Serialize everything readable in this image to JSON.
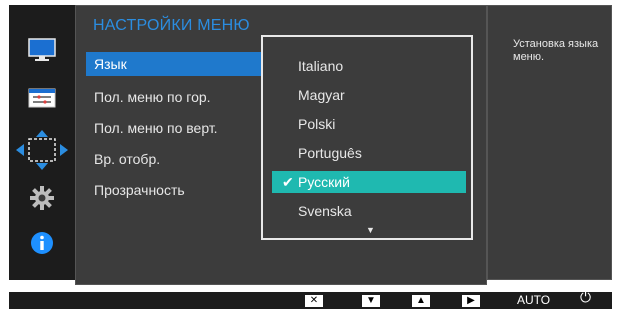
{
  "menu": {
    "title": "НАСТРОЙКИ МЕНЮ",
    "items": [
      {
        "label": "Язык",
        "selected": true
      },
      {
        "label": "Пол. меню по гор.",
        "selected": false
      },
      {
        "label": "Пол. меню по верт.",
        "selected": false
      },
      {
        "label": "Вр. отобр.",
        "selected": false
      },
      {
        "label": "Прозрачность",
        "selected": false
      }
    ]
  },
  "language_dropdown": {
    "options": [
      {
        "label": "Italiano",
        "selected": false
      },
      {
        "label": "Magyar",
        "selected": false
      },
      {
        "label": "Polski",
        "selected": false
      },
      {
        "label": "Português",
        "selected": false
      },
      {
        "label": "Русский",
        "selected": true
      },
      {
        "label": "Svenska",
        "selected": false
      }
    ],
    "check_glyph": "✔",
    "more_glyph": "▼"
  },
  "help": {
    "text": "Установка языка меню."
  },
  "sidebar_icons": [
    "picture-icon",
    "onscreen-display-icon",
    "position-adjust-icon",
    "settings-gear-icon",
    "info-icon"
  ],
  "bottom_bar": {
    "close_glyph": "✕",
    "down_glyph": "▼",
    "up_glyph": "▲",
    "enter_glyph": "▶",
    "auto_label": "AUTO",
    "power_glyph": "⏻"
  },
  "colors": {
    "accent_blue": "#1f79cc",
    "title_blue": "#2b8de0",
    "selected_teal": "#1fb9b0",
    "info_blue": "#1e90ff"
  }
}
